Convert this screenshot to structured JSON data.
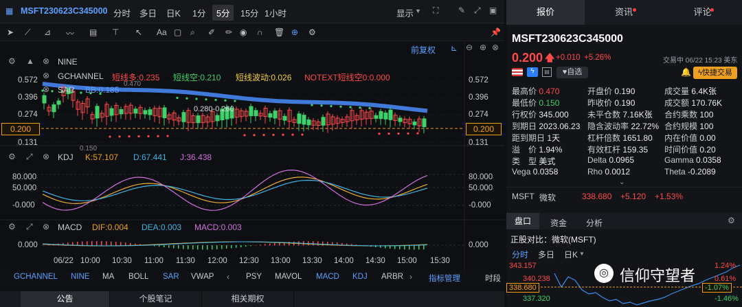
{
  "topbar": {
    "symbol": "MSFT230623C345000",
    "periods": [
      "分时",
      "多日",
      "日K",
      "1分",
      "5分",
      "15分",
      "1小时"
    ],
    "display_label": "显示"
  },
  "chart_header": {
    "adjust_label": "前复权"
  },
  "main_panel": {
    "nine_label": "NINE",
    "gchannel_label": "GCHANNEL",
    "short_long": "短线多:0.235",
    "short_short": "短线空:0.210",
    "short_wave": "短线波动:0.026",
    "notext": "NOTEXT短线空0:0.000",
    "sar_label": "SAR",
    "bb_label": "BB:0.185",
    "annotation_range": "0.280-0.260",
    "annotation_470": "0.470",
    "annotation_150": "0.150",
    "y_ticks_left": [
      "0.572",
      "0.396",
      "0.274",
      "0.200",
      "0.131"
    ],
    "y_ticks_right": [
      "0.572",
      "0.396",
      "0.274",
      "0.200",
      "0.131"
    ],
    "last_price": "0.200"
  },
  "kdj_panel": {
    "label": "KDJ",
    "k": "K:57.107",
    "d": "D:67.441",
    "j": "J:36.438",
    "y_ticks": [
      "80.000",
      "50.000",
      "-0.000"
    ]
  },
  "macd_panel": {
    "label": "MACD",
    "dif": "DIF:0.004",
    "dea": "DEA:0.003",
    "macd": "MACD:0.003",
    "y_ticks": [
      "0.000"
    ]
  },
  "time_axis": [
    "06/22",
    "10:00",
    "10:30",
    "11:00",
    "11:30",
    "12:00",
    "12:30",
    "13:00",
    "13:30",
    "14:00",
    "14:30",
    "15:00",
    "15:30"
  ],
  "indicator_bar": {
    "items": [
      "GCHANNEL",
      "NINE",
      "MA",
      "BOLL",
      "SAR",
      "VWAP",
      "PSY",
      "MAVOL",
      "MACD",
      "KDJ",
      "ARBR"
    ],
    "manage_label": "指标管理",
    "time_label": "时段"
  },
  "bottom_tabs": [
    "公告",
    "个股笔记",
    "相关期权"
  ],
  "right": {
    "tabs": [
      "报价",
      "资讯",
      "评论"
    ],
    "symbol": "MSFT230623C345000",
    "price": "0.200",
    "change": "+0.010",
    "change_pct": "+5.26%",
    "trade_time": "交易中 06/22 15:23 美东",
    "watch_label": "自选",
    "quick_trade_label": "快捷交易",
    "stats": [
      [
        {
          "k": "最高价",
          "v": "0.470"
        },
        {
          "k": "开盘价",
          "v": "0.190"
        },
        {
          "k": "成交量",
          "v": "6.4K张"
        }
      ],
      [
        {
          "k": "最低价",
          "v": "0.150"
        },
        {
          "k": "昨收价",
          "v": "0.190"
        },
        {
          "k": "成交额",
          "v": "170.76K"
        }
      ],
      [
        {
          "k": "行权价",
          "v": "345.000"
        },
        {
          "k": "未平仓数",
          "v": "7.16K张"
        },
        {
          "k": "合约乘数",
          "v": "100"
        }
      ],
      [
        {
          "k": "到期日",
          "v": "2023.06.23"
        },
        {
          "k": "隐含波动率",
          "v": "22.72%"
        },
        {
          "k": "合约规模",
          "v": "100"
        }
      ],
      [
        {
          "k": "距到期日",
          "v": "1天"
        },
        {
          "k": "杠杆倍数",
          "v": "1651.80"
        },
        {
          "k": "内在价值",
          "v": "0.00"
        }
      ],
      [
        {
          "k": "溢　价",
          "v": "1.94%"
        },
        {
          "k": "有效杠杆",
          "v": "159.35"
        },
        {
          "k": "时间价值",
          "v": "0.20"
        }
      ],
      [
        {
          "k": "类　型",
          "v": "美式"
        },
        {
          "k": "Delta",
          "v": "0.0965"
        },
        {
          "k": "Gamma",
          "v": "0.0358"
        }
      ],
      [
        {
          "k": "Vega",
          "v": "0.0358"
        },
        {
          "k": "Rho",
          "v": "0.0012"
        },
        {
          "k": "Theta",
          "v": "-0.2089"
        }
      ]
    ],
    "underlying": {
      "code": "MSFT",
      "name": "微软",
      "price": "338.680",
      "change": "+5.120",
      "change_pct": "+1.53%"
    },
    "sub_tabs": [
      "盘口",
      "资金",
      "分析"
    ],
    "compare_label": "正股对比：微软(MSFT)",
    "mini_periods": [
      "分时",
      "多日",
      "日K"
    ],
    "mini_ticks": [
      "343.157",
      "340.238",
      "338.680",
      "337.320"
    ],
    "mini_pcts": [
      "1.24%",
      "0.61%",
      "-1.07%",
      "-1.46%"
    ],
    "watermark": "信仰守望者"
  }
}
